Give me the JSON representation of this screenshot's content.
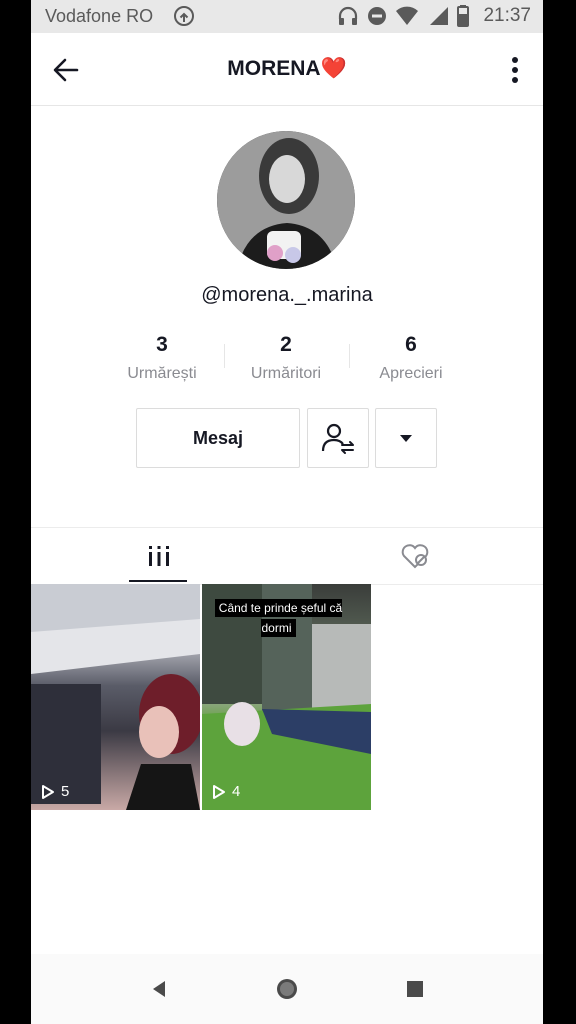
{
  "status_bar": {
    "carrier": "Vodafone RO",
    "time": "21:37"
  },
  "header": {
    "title": "MORENA",
    "title_emoji": "❤️"
  },
  "profile": {
    "username": "@morena._.marina"
  },
  "stats": [
    {
      "value": "3",
      "label": "Urmărești"
    },
    {
      "value": "2",
      "label": "Urmăritori"
    },
    {
      "value": "6",
      "label": "Aprecieri"
    }
  ],
  "actions": {
    "message_label": "Mesaj"
  },
  "videos": [
    {
      "plays": "5",
      "caption": ""
    },
    {
      "plays": "4",
      "caption": "Când te prinde șeful că dormi"
    }
  ],
  "icons": {
    "back": "arrow-left-icon",
    "more": "more-vertical-icon",
    "follow": "user-follow-icon",
    "dropdown": "caret-down-icon",
    "videos_tab": "grid-icon",
    "liked_tab": "heart-hidden-icon"
  }
}
